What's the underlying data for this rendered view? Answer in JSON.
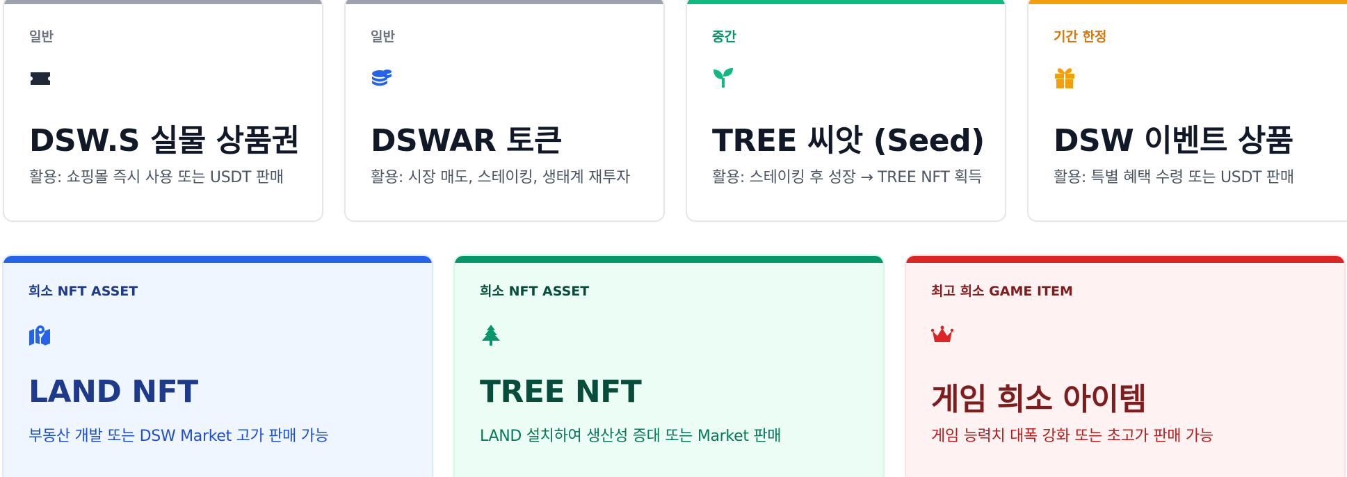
{
  "top_cards": [
    {
      "badge": "일반",
      "icon": "ticket-icon",
      "title": "DSW.S 실물 상품권",
      "desc": "활용: 쇼핑몰 즉시 사용 또는 USDT 판매",
      "bar_color": "#9ca3af",
      "badge_color": "#6b7280",
      "icon_color": "#1f2937"
    },
    {
      "badge": "일반",
      "icon": "coins-icon",
      "title": "DSWAR 토큰",
      "desc": "활용: 시장 매도, 스테이킹, 생태계 재투자",
      "bar_color": "#9ca3af",
      "badge_color": "#6b7280",
      "icon_color": "#2563eb"
    },
    {
      "badge": "중간",
      "icon": "seedling-icon",
      "title": "TREE 씨앗 (Seed)",
      "desc": "활용: 스테이킹 후 성장 → TREE NFT 획득",
      "bar_color": "#10b981",
      "badge_color": "#059669",
      "icon_color": "#10b981"
    },
    {
      "badge": "기간 한정",
      "icon": "gift-icon",
      "title": "DSW 이벤트 상품",
      "desc": "활용: 특별 혜택 수령 또는 USDT 판매",
      "bar_color": "#f59e0b",
      "badge_color": "#d97706",
      "icon_color": "#f59e0b"
    }
  ],
  "bottom_cards": [
    {
      "badge": "희소 NFT ASSET",
      "icon": "map-icon",
      "title": "LAND NFT",
      "desc": "부동산 개발 또는 DSW Market 고가 판매 가능",
      "bar_color": "#2563eb",
      "bg_color": "#eff6ff",
      "border_color": "#dbeafe",
      "text_color": "#1e3a8a",
      "desc_color": "#1d4ed8",
      "icon_color": "#2563eb"
    },
    {
      "badge": "희소 NFT ASSET",
      "icon": "tree-icon",
      "title": "TREE NFT",
      "desc": "LAND 설치하여 생산성 증대 또는 Market 판매",
      "bar_color": "#059669",
      "bg_color": "#ecfdf5",
      "border_color": "#d1fae5",
      "text_color": "#064e3b",
      "desc_color": "#047857",
      "icon_color": "#059669"
    },
    {
      "badge": "최고 희소 GAME ITEM",
      "icon": "crown-icon",
      "title": "게임 희소 아이템",
      "desc": "게임 능력치 대폭 강화 또는 초고가 판매 가능",
      "bar_color": "#dc2626",
      "bg_color": "#fef2f2",
      "border_color": "#fee2e2",
      "text_color": "#7f1d1d",
      "desc_color": "#b91c1c",
      "icon_color": "#dc2626"
    }
  ]
}
